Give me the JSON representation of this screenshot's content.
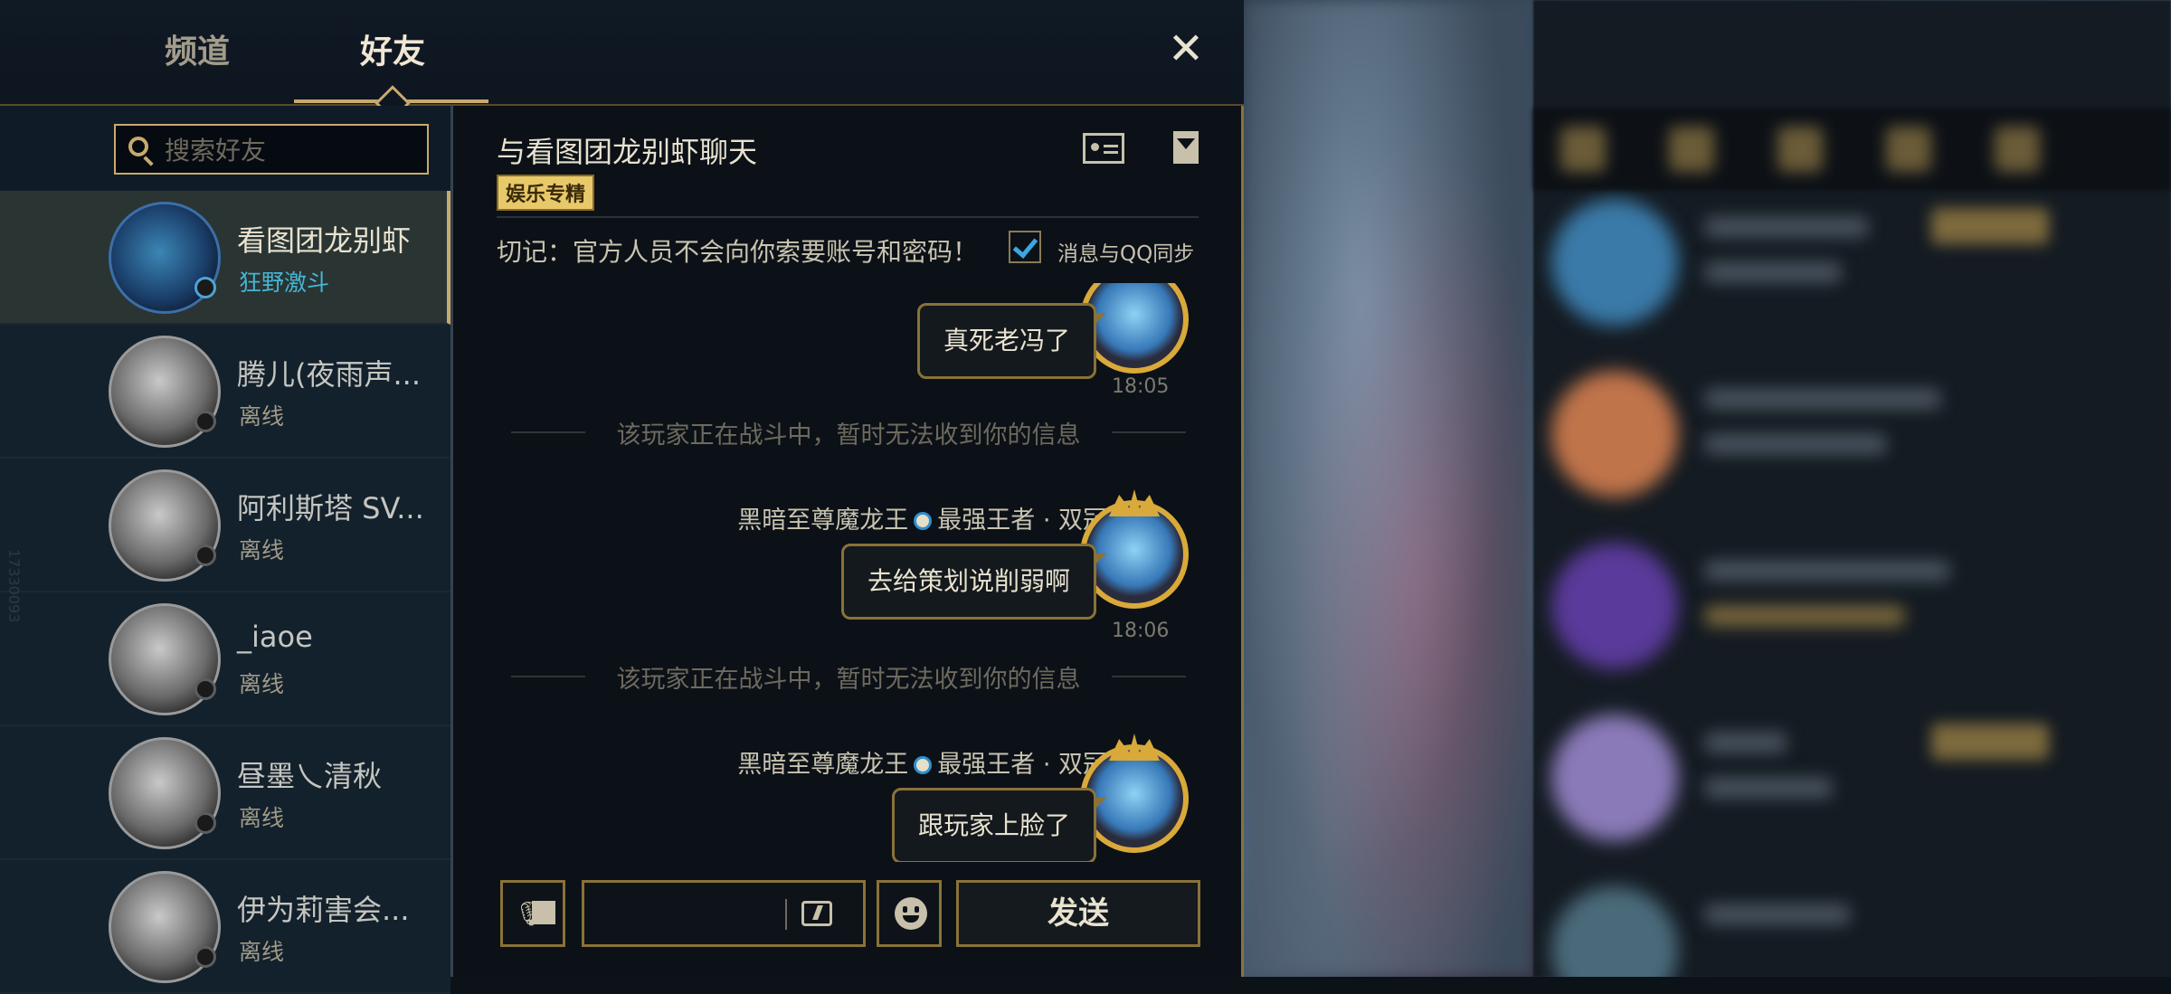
{
  "tabs": {
    "channel": "频道",
    "friends": "好友"
  },
  "search": {
    "placeholder": "搜索好友",
    "value": ""
  },
  "friends": [
    {
      "name": "看图团龙别虾",
      "status": "狂野激斗",
      "selected": true
    },
    {
      "name": "腾儿(夜雨声...",
      "status": "离线"
    },
    {
      "name": "阿利斯塔 SV...",
      "status": "离线"
    },
    {
      "name": "_iaoe",
      "status": "离线"
    },
    {
      "name": "昼墨乀清秋",
      "status": "离线"
    },
    {
      "name": "伊为莉害会...",
      "status": "离线"
    }
  ],
  "side_watermark": "17330093",
  "chat": {
    "title": "与看图团龙别虾聊天",
    "tag": "娱乐专精",
    "notice": "切记：官方人员不会向你索要账号和密码！",
    "qq_sync_label": "消息与QQ同步",
    "qq_sync_checked": true,
    "messages": [
      {
        "type": "text",
        "text": "真死老冯了",
        "time": "18:05"
      },
      {
        "type": "system",
        "text": "该玩家正在战斗中，暂时无法收到你的信息"
      },
      {
        "type": "text",
        "sender": "黑暗至尊魔龙王",
        "rank": "最强王者 · 双冠",
        "text": "去给策划说削弱啊",
        "time": "18:06"
      },
      {
        "type": "system",
        "text": "该玩家正在战斗中，暂时无法收到你的信息"
      },
      {
        "type": "text",
        "sender": "黑暗至尊魔龙王",
        "rank": "最强王者 · 双冠",
        "text": "跟玩家上脸了"
      }
    ]
  },
  "input": {
    "placeholder": "",
    "send_label": "发送"
  },
  "colors": {
    "accent": "#c8aa6e",
    "online": "#45b6d6",
    "background": "#0b1117"
  }
}
